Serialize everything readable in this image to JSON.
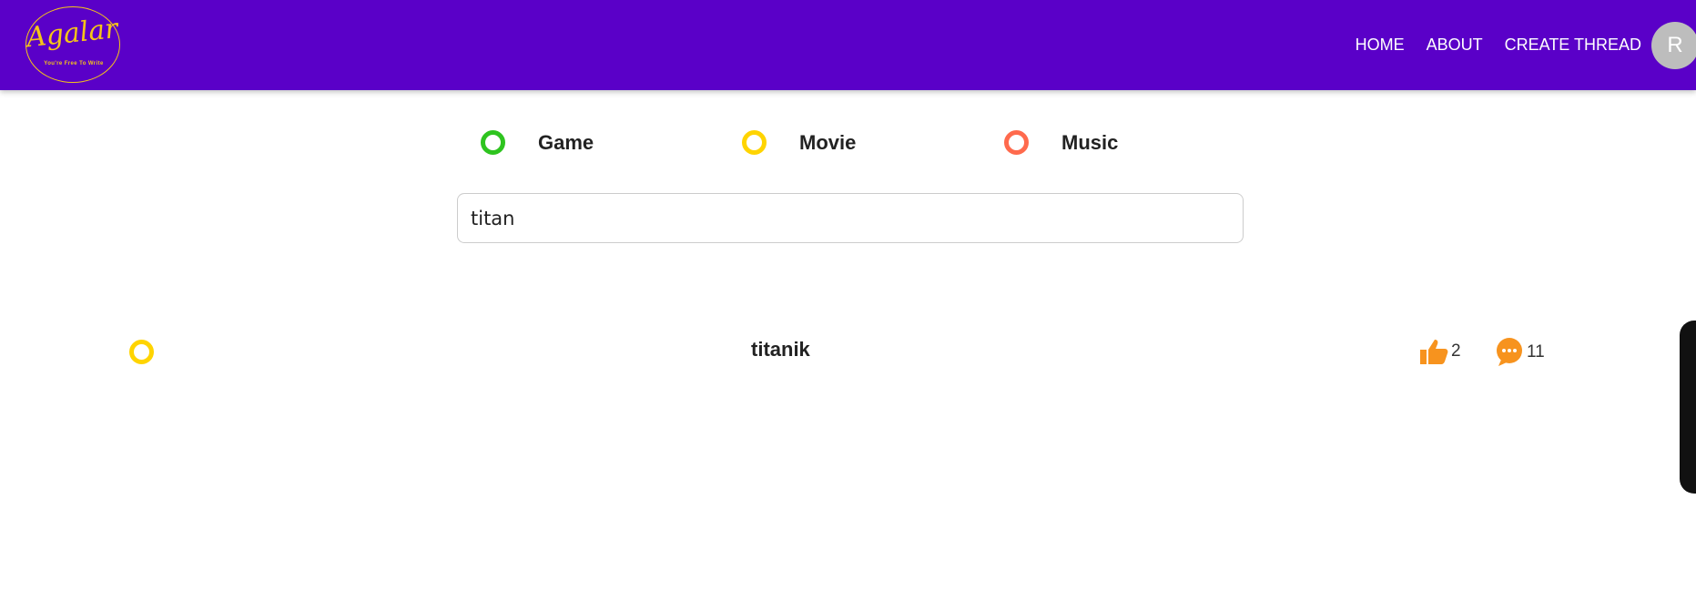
{
  "logo": {
    "name": "Agalar",
    "tagline": "You're Free To Write"
  },
  "nav": {
    "links": [
      "HOME",
      "ABOUT",
      "CREATE THREAD"
    ],
    "avatar_initial": "R"
  },
  "categories": [
    {
      "label": "Game",
      "color": "#2ec41f"
    },
    {
      "label": "Movie",
      "color": "#ffd400"
    },
    {
      "label": "Music",
      "color": "#ff6a4d"
    }
  ],
  "search": {
    "value": "titan"
  },
  "threads": [
    {
      "title": "titanik",
      "category_color": "#ffd400",
      "likes": "2",
      "comments": "11"
    }
  ],
  "colors": {
    "navbar": "#5a00c8",
    "logo_accent": "#f5c518",
    "stat_icon": "#f7931e"
  },
  "icons": {
    "like": "thumbs-up-icon",
    "comment": "chat-bubble-icon"
  }
}
